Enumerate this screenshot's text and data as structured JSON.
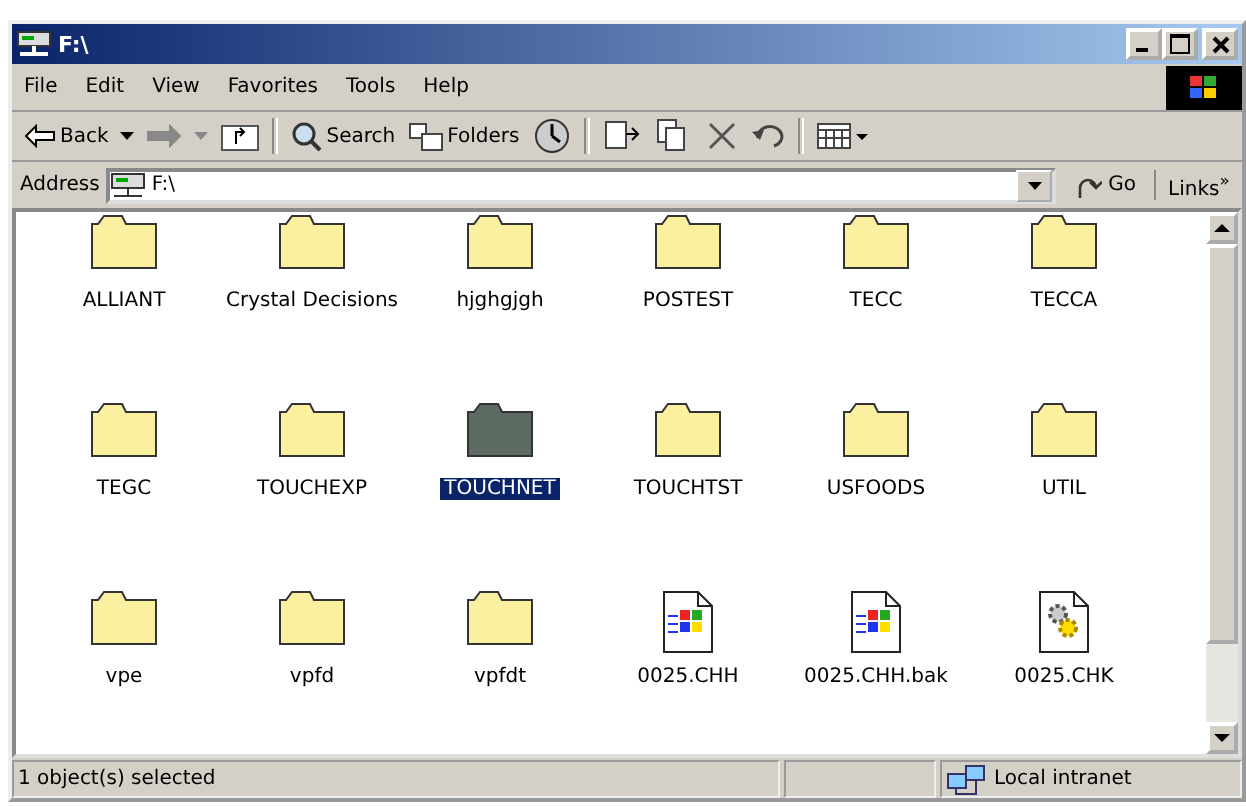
{
  "window": {
    "title": "F:\\"
  },
  "menu": [
    "File",
    "Edit",
    "View",
    "Favorites",
    "Tools",
    "Help"
  ],
  "toolbar": {
    "back": "Back",
    "search": "Search",
    "folders": "Folders",
    "forward_disabled": true
  },
  "address": {
    "label": "Address",
    "value": "F:\\",
    "go": "Go",
    "links": "Links",
    "more": "»"
  },
  "items": [
    {
      "name": "ALLIANT",
      "kind": "folder",
      "selected": false
    },
    {
      "name": "Crystal Decisions",
      "kind": "folder",
      "selected": false
    },
    {
      "name": "hjghgjgh",
      "kind": "folder",
      "selected": false
    },
    {
      "name": "POSTEST",
      "kind": "folder",
      "selected": false
    },
    {
      "name": "TECC",
      "kind": "folder",
      "selected": false
    },
    {
      "name": "TECCA",
      "kind": "folder",
      "selected": false
    },
    {
      "name": "TEGC",
      "kind": "folder",
      "selected": false
    },
    {
      "name": "TOUCHEXP",
      "kind": "folder",
      "selected": false
    },
    {
      "name": "TOUCHNET",
      "kind": "folder",
      "selected": true
    },
    {
      "name": "TOUCHTST",
      "kind": "folder",
      "selected": false
    },
    {
      "name": "USFOODS",
      "kind": "folder",
      "selected": false
    },
    {
      "name": "UTIL",
      "kind": "folder",
      "selected": false
    },
    {
      "name": "vpe",
      "kind": "folder",
      "selected": false
    },
    {
      "name": "vpfd",
      "kind": "folder",
      "selected": false
    },
    {
      "name": "vpfdt",
      "kind": "folder",
      "selected": false
    },
    {
      "name": "0025.CHH",
      "kind": "document",
      "selected": false
    },
    {
      "name": "0025.CHH.bak",
      "kind": "document",
      "selected": false
    },
    {
      "name": "0025.CHK",
      "kind": "system",
      "selected": false
    }
  ],
  "status": {
    "text": "1 object(s) selected",
    "zone": "Local intranet"
  }
}
